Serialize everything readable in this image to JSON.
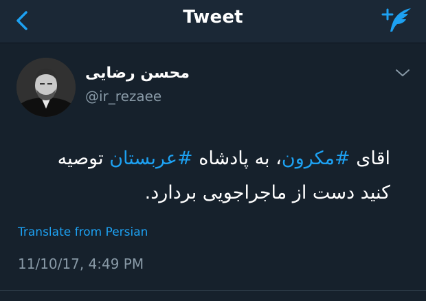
{
  "navbar": {
    "title": "Tweet",
    "back_icon": "chevron-left-icon",
    "compose_icon": "compose-tweet-icon",
    "accent": "#1da1f2"
  },
  "tweet": {
    "author": {
      "display_name": "محسن رضایی",
      "handle": "@ir_rezaee"
    },
    "text": {
      "line1": {
        "p1": "اقای ",
        "tag1": "#مکرون",
        "p2": "، به پادشاه ",
        "tag2": "#عربستان",
        "p3": " توصیه"
      },
      "line2": "کنید دست از ماجراجویی بردارد."
    },
    "translate_label": "Translate from Persian",
    "timestamp": "11/10/17, 4:49 PM"
  },
  "colors": {
    "background": "#16212c",
    "navbar": "#1b2836",
    "secondary_text": "#8899a6",
    "link": "#1da1f2"
  }
}
